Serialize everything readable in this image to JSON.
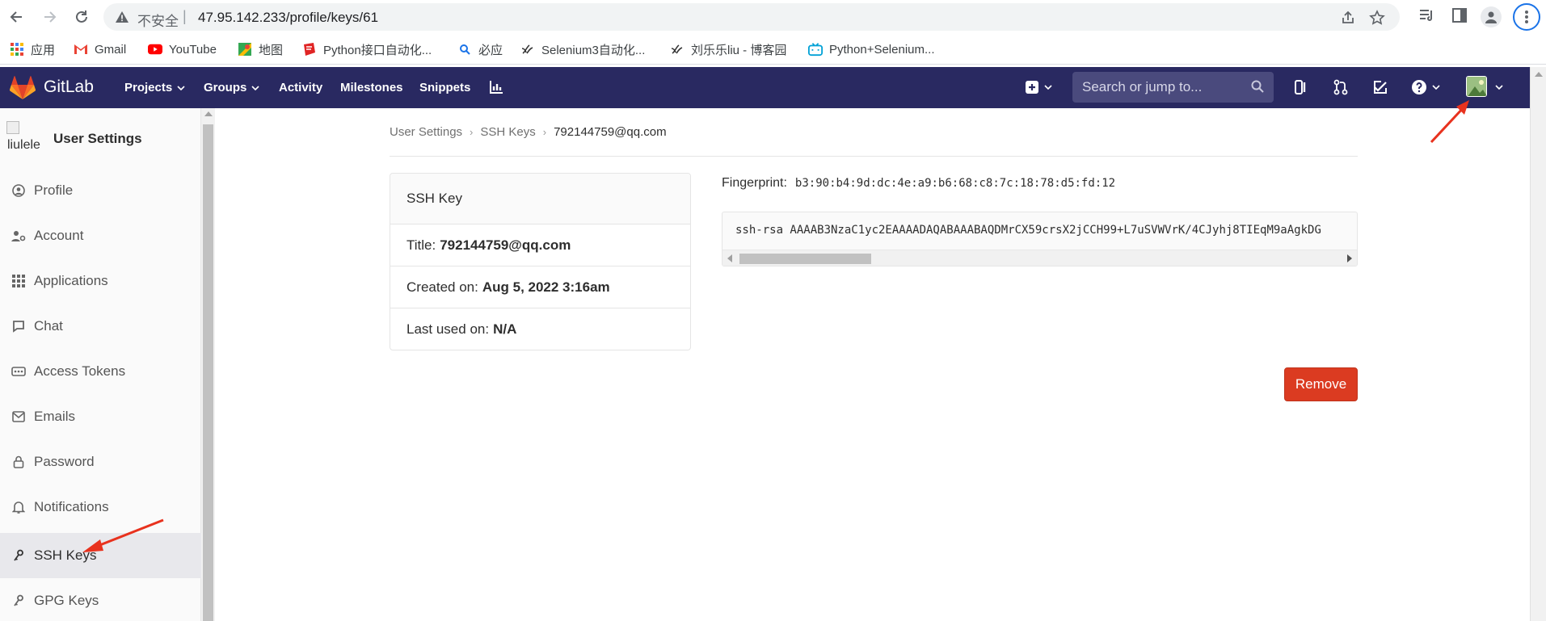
{
  "browser": {
    "insecure_label": "不安全",
    "separator": "|",
    "url": "47.95.142.233/profile/keys/61",
    "bookmarks": [
      {
        "label": "应用",
        "icon": "apps-grid-icon"
      },
      {
        "label": "Gmail",
        "icon": "gmail-icon"
      },
      {
        "label": "YouTube",
        "icon": "youtube-icon"
      },
      {
        "label": "地图",
        "icon": "maps-icon"
      },
      {
        "label": "Python接口自动化...",
        "icon": "bookmark-red-icon"
      },
      {
        "label": "必应",
        "icon": "bing-search-icon"
      },
      {
        "label": "Selenium3自动化...",
        "icon": "cnblogs-icon"
      },
      {
        "label": "刘乐乐liu - 博客园",
        "icon": "cnblogs-icon"
      },
      {
        "label": "Python+Selenium...",
        "icon": "bilibili-icon"
      }
    ]
  },
  "gitlab": {
    "brand": "GitLab",
    "nav": [
      {
        "label": "Projects",
        "dropdown": true
      },
      {
        "label": "Groups",
        "dropdown": true
      },
      {
        "label": "Activity",
        "dropdown": false
      },
      {
        "label": "Milestones",
        "dropdown": false
      },
      {
        "label": "Snippets",
        "dropdown": false
      }
    ],
    "search_placeholder": "Search or jump to..."
  },
  "sidebar": {
    "avatar_alt": "liulele",
    "title": "User Settings",
    "items": [
      {
        "label": "Profile",
        "icon": "profile-icon",
        "active": false
      },
      {
        "label": "Account",
        "icon": "account-icon",
        "active": false
      },
      {
        "label": "Applications",
        "icon": "applications-icon",
        "active": false
      },
      {
        "label": "Chat",
        "icon": "chat-icon",
        "active": false
      },
      {
        "label": "Access Tokens",
        "icon": "access-tokens-icon",
        "active": false
      },
      {
        "label": "Emails",
        "icon": "emails-icon",
        "active": false
      },
      {
        "label": "Password",
        "icon": "lock-icon",
        "active": false
      },
      {
        "label": "Notifications",
        "icon": "bell-icon",
        "active": false
      },
      {
        "label": "SSH Keys",
        "icon": "key-icon",
        "active": true
      },
      {
        "label": "GPG Keys",
        "icon": "key-icon",
        "active": false
      }
    ]
  },
  "breadcrumb": {
    "items": [
      "User Settings",
      "SSH Keys"
    ],
    "current": "792144759@qq.com"
  },
  "key_card": {
    "header": "SSH Key",
    "title_label": "Title:",
    "title_value": "792144759@qq.com",
    "created_label": "Created on:",
    "created_value": "Aug 5, 2022 3:16am",
    "last_used_label": "Last used on:",
    "last_used_value": "N/A"
  },
  "fingerprint": {
    "label": "Fingerprint:",
    "value": "b3:90:b4:9d:dc:4e:a9:b6:68:c8:7c:18:78:d5:fd:12"
  },
  "public_key": "ssh-rsa AAAAB3NzaC1yc2EAAAADAQABAAABAQDMrCX59crsX2jCCH99+L7uSVWVrK/4CJyhj8TIEqM9aAgkDG",
  "actions": {
    "remove_label": "Remove"
  },
  "colors": {
    "header_bg": "#292961",
    "remove_bg": "#db3b21",
    "annotation_arrow": "#e8321e"
  }
}
